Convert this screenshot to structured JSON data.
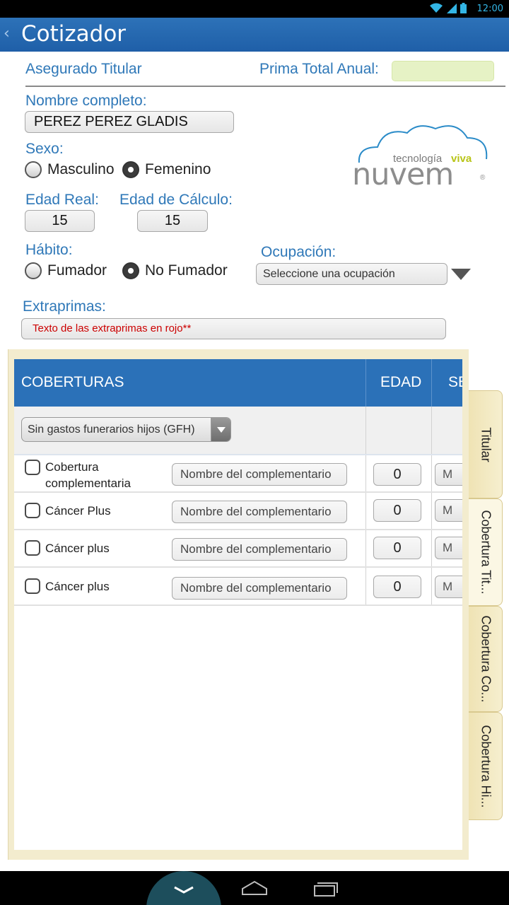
{
  "status_bar": {
    "time": "12:00",
    "icons": [
      "wifi-icon",
      "signal-icon",
      "battery-icon"
    ]
  },
  "action_bar": {
    "title": "Cotizador"
  },
  "form": {
    "section_title": "Asegurado Titular",
    "prima_label": "Prima Total Anual:",
    "prima_value": "",
    "nombre_label": "Nombre completo:",
    "nombre_value": "PEREZ PEREZ GLADIS",
    "sexo_label": "Sexo:",
    "sexo_options": [
      "Masculino",
      "Femenino"
    ],
    "sexo_selected": "Femenino",
    "edad_real_label": "Edad Real:",
    "edad_real_value": "15",
    "edad_calculo_label": "Edad de Cálculo:",
    "edad_calculo_value": "15",
    "habito_label": "Hábito:",
    "habito_options": [
      "Fumador",
      "No Fumador"
    ],
    "habito_selected": "No Fumador",
    "ocupacion_label": "Ocupación:",
    "ocupacion_value": "Seleccione una ocupación",
    "extraprimas_label": "Extraprimas:",
    "extraprimas_value": "Texto de las extraprimas en rojo**"
  },
  "logo": {
    "tagline_1": "tecnología",
    "tagline_2": "viva",
    "brand": "nuvem",
    "registered": "®"
  },
  "table": {
    "headers": [
      "COBERTURAS",
      "EDAD",
      "SE"
    ],
    "filter_value": "Sin gastos funerarios hijos (GFH)",
    "rows": [
      {
        "label": "Cobertura complementaria",
        "name_placeholder": "Nombre del complementario",
        "age": "0",
        "sex": "M"
      },
      {
        "label": "Cáncer Plus",
        "name_placeholder": "Nombre del complementario",
        "age": "0",
        "sex": "M"
      },
      {
        "label": "Cáncer plus",
        "name_placeholder": "Nombre del complementario",
        "age": "0",
        "sex": "M"
      },
      {
        "label": "Cáncer plus",
        "name_placeholder": "Nombre del complementario",
        "age": "0",
        "sex": "M"
      }
    ]
  },
  "side_tabs": [
    "Titular",
    "Cobertura Tit...",
    "Cobertura Co...",
    "Cobertura Hi..."
  ],
  "side_tab_active": "Cobertura Tit...",
  "colors": {
    "accent_blue": "#2b71b8",
    "label_blue": "#2f78b8",
    "panel_beige": "#f3ecce",
    "prima_green": "#e6f2c5",
    "extraprimas_red": "#cc0000"
  }
}
